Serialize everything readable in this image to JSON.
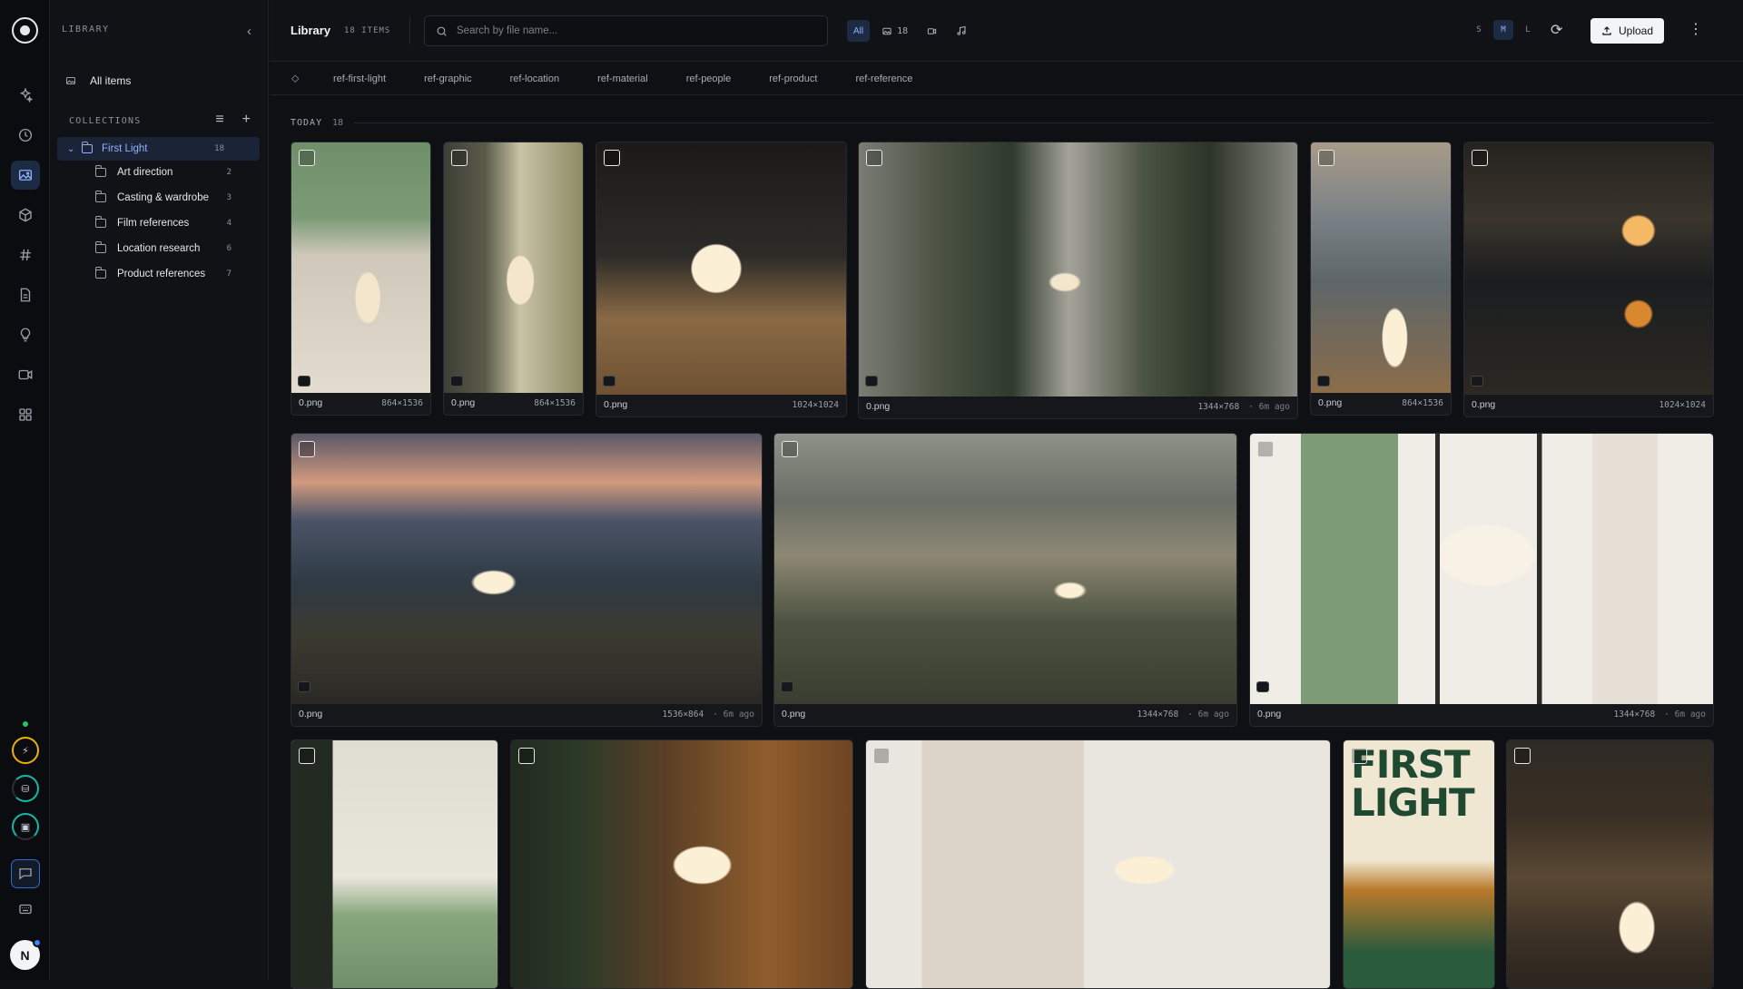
{
  "sidebar": {
    "header": "LIBRARY",
    "all_items": "All items",
    "collections_label": "COLLECTIONS",
    "root": {
      "label": "First Light",
      "count": "18"
    },
    "folders": [
      {
        "label": "Art direction",
        "count": "2"
      },
      {
        "label": "Casting & wardrobe",
        "count": "3"
      },
      {
        "label": "Film references",
        "count": "4"
      },
      {
        "label": "Location research",
        "count": "6"
      },
      {
        "label": "Product references",
        "count": "7"
      }
    ]
  },
  "header": {
    "title": "Library",
    "count": "18 ITEMS",
    "search_placeholder": "Search by file name...",
    "filter_all": "All",
    "filter_images_count": "18",
    "sizes": [
      "S",
      "M",
      "L"
    ],
    "upload_label": "Upload"
  },
  "tags": [
    "ref-first-light",
    "ref-graphic",
    "ref-location",
    "ref-material",
    "ref-people",
    "ref-product",
    "ref-reference"
  ],
  "section": {
    "label": "TODAY",
    "count": "18"
  },
  "cards": [
    {
      "name": "0.png",
      "dims": "864×1536",
      "ago": ""
    },
    {
      "name": "0.png",
      "dims": "864×1536",
      "ago": ""
    },
    {
      "name": "0.png",
      "dims": "1024×1024",
      "ago": ""
    },
    {
      "name": "0.png",
      "dims": "1344×768",
      "ago": "6m ago"
    },
    {
      "name": "0.png",
      "dims": "864×1536",
      "ago": ""
    },
    {
      "name": "0.png",
      "dims": "1024×1024",
      "ago": ""
    },
    {
      "name": "0.png",
      "dims": "1536×864",
      "ago": "6m ago"
    },
    {
      "name": "0.png",
      "dims": "1344×768",
      "ago": "6m ago"
    },
    {
      "name": "0.png",
      "dims": "1344×768",
      "ago": "6m ago"
    },
    {
      "name": "",
      "dims": "",
      "ago": ""
    },
    {
      "name": "",
      "dims": "",
      "ago": ""
    },
    {
      "name": "",
      "dims": "",
      "ago": ""
    },
    {
      "name": "",
      "dims": "",
      "ago": ""
    },
    {
      "name": "",
      "dims": "",
      "ago": ""
    }
  ],
  "poster_text": "FIRST LIGHT",
  "colors": {
    "accent": "#8fb1ff",
    "accent_bg": "#1d2a44",
    "status_green": "#22c55e"
  }
}
